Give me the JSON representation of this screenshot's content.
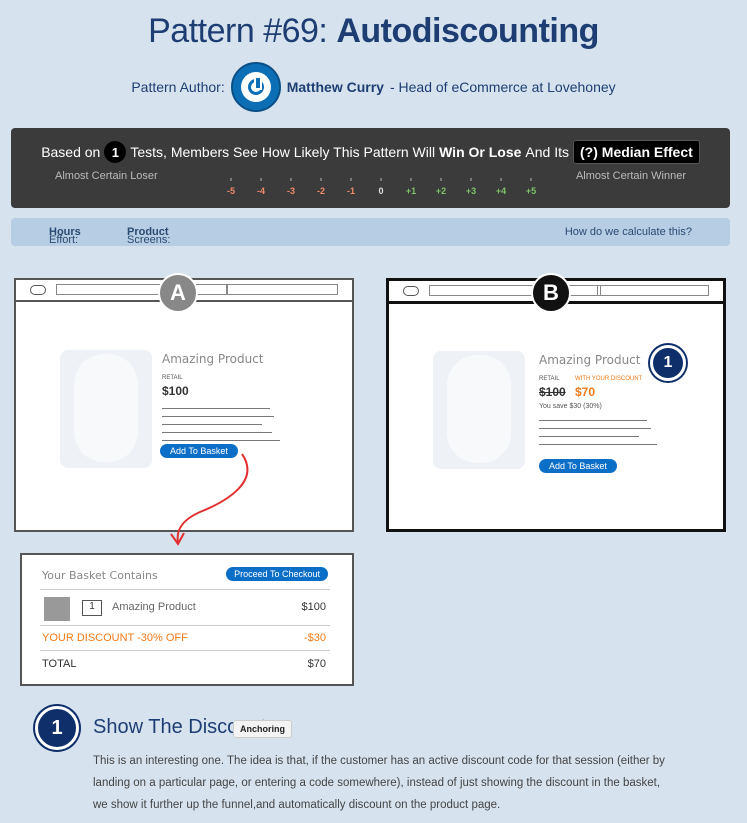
{
  "header": {
    "title_prefix": "Pattern #69: ",
    "title_bold": "Autodiscounting"
  },
  "author": {
    "label": "Pattern Author:",
    "name": "Matthew Curry",
    "role": " - Head of eCommerce at Lovehoney"
  },
  "stats": {
    "based_on": "Based on",
    "count": "1",
    "middle": "Tests, Members See How Likely This Pattern Will",
    "win_lose": "Win Or Lose",
    "and_its": "And Its",
    "median": "(?) Median Effect",
    "loser": "Almost Certain Loser",
    "winner": "Almost Certain Winner",
    "scale": [
      "-5",
      "-4",
      "-3",
      "-2",
      "-1",
      "0",
      "+1",
      "+2",
      "+3",
      "+4",
      "+5"
    ]
  },
  "meta": {
    "effort_label": "Effort:",
    "effort": "Hours",
    "screens_label": "Screens:",
    "screens": "Product",
    "calc": "How do we calculate this?"
  },
  "variant_a": {
    "letter": "A",
    "product": "Amazing Product",
    "retail": "RETAIL",
    "price": "$100",
    "button": "Add To Basket"
  },
  "variant_b": {
    "letter": "B",
    "product": "Amazing Product",
    "retail": "RETAIL",
    "old_price": "$100",
    "with_discount": "WITH YOUR DISCOUNT",
    "new_price": "$70",
    "save": "You save $30 (30%)",
    "button": "Add To Basket",
    "marker": "1"
  },
  "basket": {
    "title": "Your Basket Contains",
    "checkout": "Proceed To Checkout",
    "qty": "1",
    "item": "Amazing Product",
    "item_price": "$100",
    "discount": "YOUR DISCOUNT -30% OFF",
    "discount_value": "-$30",
    "total_label": "TOTAL",
    "total": "$70"
  },
  "section": {
    "num": "1",
    "title": "Show The Discount",
    "tag": "Anchoring",
    "text": "This is an interesting one. The idea is that, if the customer has an active discount code for that session (either by landing on a particular page, or entering a code somewhere), instead of just showing the discount in the basket, we show it further up the funnel,and automatically discount on the product page."
  },
  "colors": {
    "accent": "#1e3e73",
    "discount": "#f07a1a",
    "button": "#0c6fc7",
    "arrow": "#e23030"
  }
}
